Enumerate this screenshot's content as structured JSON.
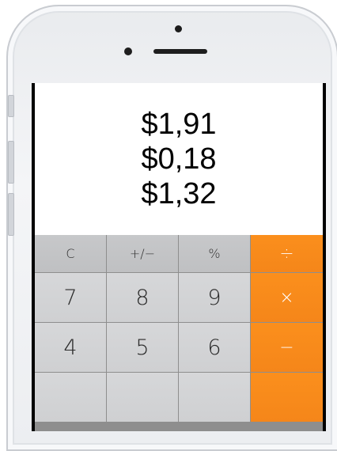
{
  "display": {
    "lines": [
      "$1,91",
      "$0,18",
      "$1,32"
    ]
  },
  "keypad": {
    "row1": [
      "C",
      "+/−",
      "%",
      "÷"
    ],
    "row2": [
      "7",
      "8",
      "9",
      "×"
    ],
    "row3": [
      "4",
      "5",
      "6",
      "−"
    ],
    "row4": [
      "",
      "",
      "",
      ""
    ]
  },
  "colors": {
    "operator": "#f5861a",
    "key": "#d2d3d5",
    "function_key": "#c4c5c7"
  }
}
